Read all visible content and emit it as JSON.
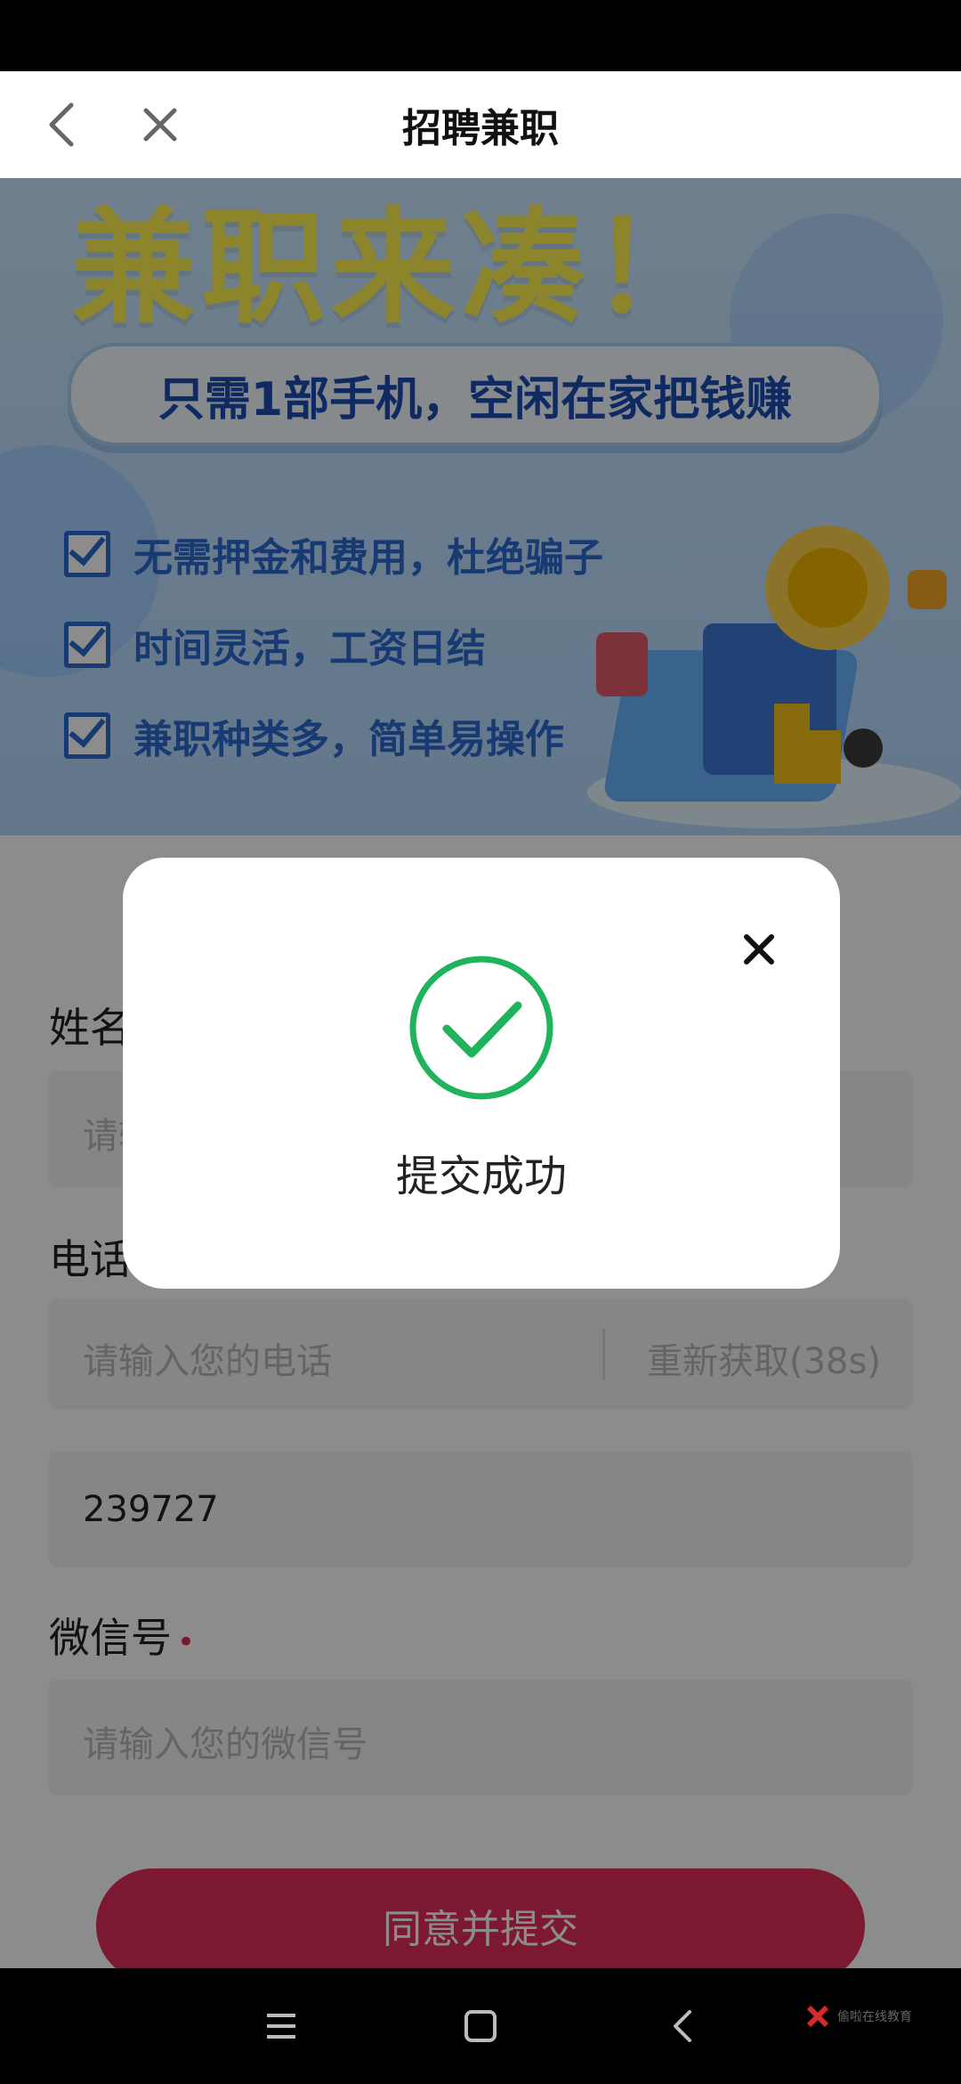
{
  "nav": {
    "title": "招聘兼职",
    "back_icon": "chevron-left-icon",
    "close_icon": "close-icon"
  },
  "banner": {
    "headline": "兼职来凑！",
    "subtitle": "只需1部手机，空闲在家把钱赚",
    "benefits": [
      "无需押金和费用，杜绝骗子",
      "时间灵活，工资日结",
      "兼职种类多，简单易操作"
    ]
  },
  "form": {
    "name_label": "姓名",
    "name_placeholder": "请输入您的姓名",
    "phone_label": "电话",
    "phone_placeholder": "请输入您的电话",
    "resend_label": "重新获取(38s)",
    "code_value": "239727",
    "wechat_label": "微信号",
    "required_mark": "•",
    "wechat_placeholder": "请输入您的微信号",
    "submit_label": "同意并提交"
  },
  "modal": {
    "message": "提交成功",
    "close_icon": "close-icon",
    "status_icon": "check-circle-icon"
  },
  "colors": {
    "accent": "#e22d58",
    "success": "#1fb35c",
    "overlay": "rgba(0,0,0,0.45)"
  },
  "system_nav": {
    "icons": [
      "menu-icon",
      "home-square-icon",
      "back-chevron-icon"
    ],
    "watermark": "偷啦在线教育"
  }
}
